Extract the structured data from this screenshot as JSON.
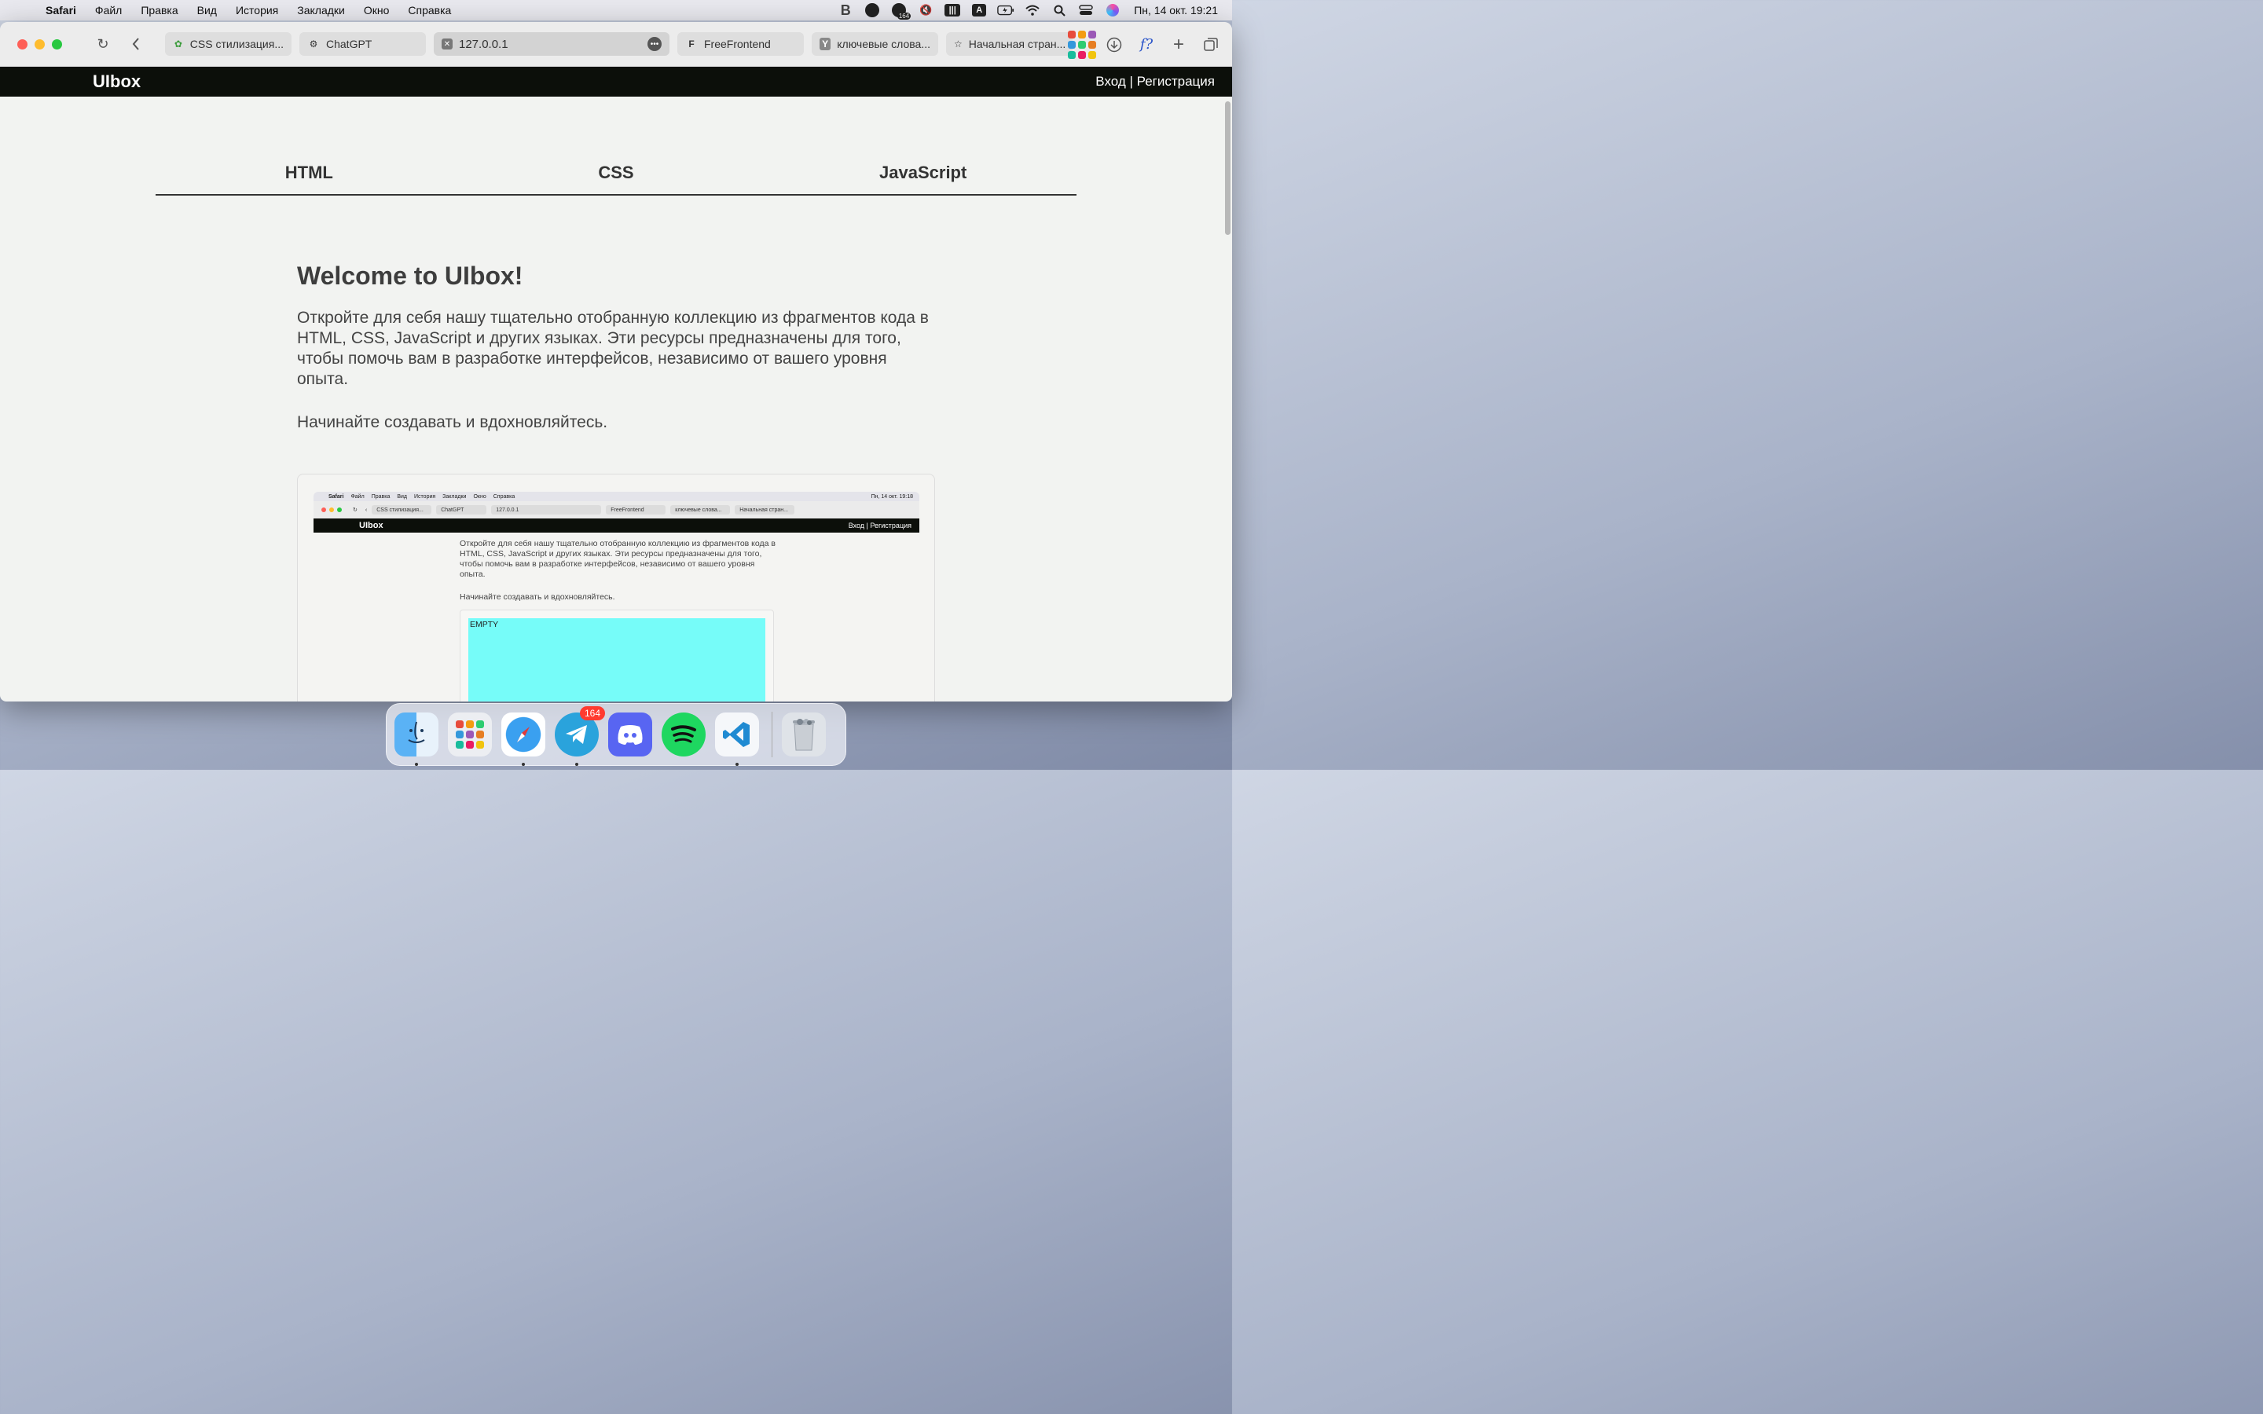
{
  "menubar": {
    "app_name": "Safari",
    "items": [
      "Файл",
      "Правка",
      "Вид",
      "История",
      "Закладки",
      "Окно",
      "Справка"
    ],
    "badge_count": "164",
    "input_source": "A",
    "clock": "Пн, 14 окт.  19:21"
  },
  "browser": {
    "tabs": [
      {
        "label": "CSS стилизация...",
        "icon": "leaf-icon"
      },
      {
        "label": "ChatGPT",
        "icon": "chatgpt-icon"
      },
      {
        "label": "127.0.0.1",
        "icon": "close-icon",
        "active": true
      },
      {
        "label": "FreeFrontend",
        "icon": "freefrontend-icon"
      },
      {
        "label": "ключевые слова...",
        "icon": "yandex-icon"
      },
      {
        "label": "Начальная стран...",
        "icon": "star-icon"
      }
    ],
    "toolbar_glyph": "f?"
  },
  "site": {
    "logo": "UIbox",
    "auth": "Вход | Регистрация",
    "lang_tabs": [
      "HTML",
      "CSS",
      "JavaScript"
    ],
    "heading": "Welcome to UIbox!",
    "intro": "Откройте для себя нашу тщательно отобранную коллекцию из фрагментов кода в HTML, CSS, JavaScript и других языках. Эти ресурсы предназначены для того, чтобы помочь вам в разработке интерфейсов, независимо от вашего уровня опыта.",
    "cta": "Начинайте создавать и вдохновляйтесь."
  },
  "preview": {
    "menubar_app": "Safari",
    "menubar_items": [
      "Файл",
      "Правка",
      "Вид",
      "История",
      "Закладки",
      "Окно",
      "Справка"
    ],
    "clock": "Пн, 14 окт.  19:18",
    "tabs": [
      "CSS стилизация...",
      "ChatGPT",
      "127.0.0.1",
      "FreeFrontend",
      "ключевые слова...",
      "Начальная стран..."
    ],
    "logo": "UIbox",
    "auth": "Вход | Регистрация",
    "intro": "Откройте для себя нашу тщательно отобранную коллекцию из фрагментов кода в HTML, CSS, JavaScript и других языках. Эти ресурсы предназначены для того, чтобы помочь вам в разработке интерфейсов, независимо от вашего уровня опыта.",
    "cta": "Начинайте создавать и вдохновляйтесь.",
    "box_label": "EMPTY",
    "box_color": "#76fcf9"
  },
  "dock": {
    "apps": [
      "Finder",
      "Launchpad",
      "Safari",
      "Telegram",
      "Discord",
      "Spotify",
      "Visual Studio Code",
      "Trash"
    ],
    "telegram_badge": "164"
  },
  "colors": {
    "header_bg": "#0c0f0a",
    "page_bg": "#f2f3f1",
    "accent_cyan": "#76fcf9"
  }
}
